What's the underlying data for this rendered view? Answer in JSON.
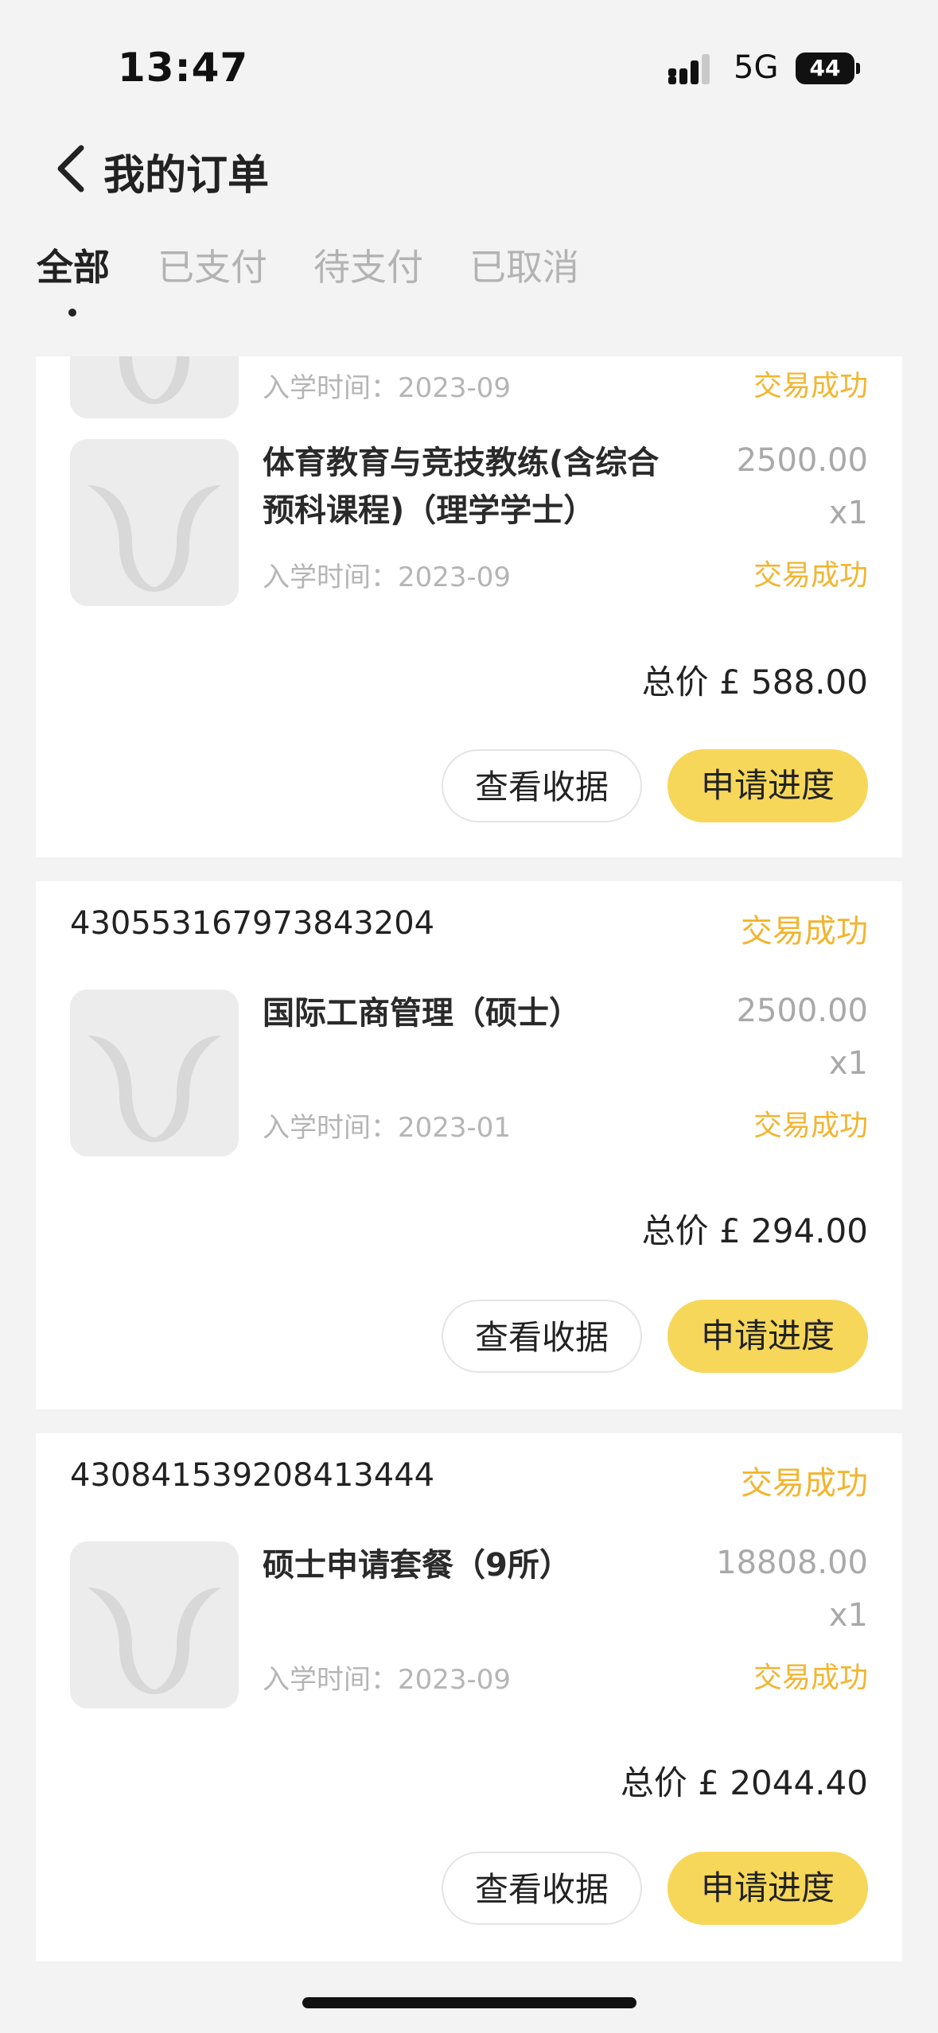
{
  "status_bar": {
    "time": "13:47",
    "network": "5G",
    "battery": "44"
  },
  "header": {
    "title": "我的订单"
  },
  "tabs": [
    {
      "label": "全部",
      "active": true
    },
    {
      "label": "已支付",
      "active": false
    },
    {
      "label": "待支付",
      "active": false
    },
    {
      "label": "已取消",
      "active": false
    }
  ],
  "orders": [
    {
      "items": [
        {
          "name": "",
          "date": "入学时间：2023-09",
          "price": "",
          "qty": "",
          "status": "交易成功"
        },
        {
          "name": "体育教育与竞技教练(含综合预科课程)（理学学士）",
          "date": "入学时间：2023-09",
          "price": "2500.00",
          "qty": "x1",
          "status": "交易成功"
        }
      ],
      "total": "总价 £ 588.00",
      "btn_receipt": "查看收据",
      "btn_progress": "申请进度"
    },
    {
      "order_no": "430553167973843204",
      "status": "交易成功",
      "items": [
        {
          "name": "国际工商管理（硕士）",
          "date": "入学时间：2023-01",
          "price": "2500.00",
          "qty": "x1",
          "status": "交易成功"
        }
      ],
      "total": "总价 £ 294.00",
      "btn_receipt": "查看收据",
      "btn_progress": "申请进度"
    },
    {
      "order_no": "430841539208413444",
      "status": "交易成功",
      "items": [
        {
          "name": "硕士申请套餐（9所）",
          "date": "入学时间：2023-09",
          "price": "18808.00",
          "qty": "x1",
          "status": "交易成功"
        }
      ],
      "total": "总价 £ 2044.40",
      "btn_receipt": "查看收据",
      "btn_progress": "申请进度"
    }
  ],
  "colors": {
    "accent": "#f6d75a",
    "success_text": "#f2b530",
    "background": "#f3f3f3"
  }
}
